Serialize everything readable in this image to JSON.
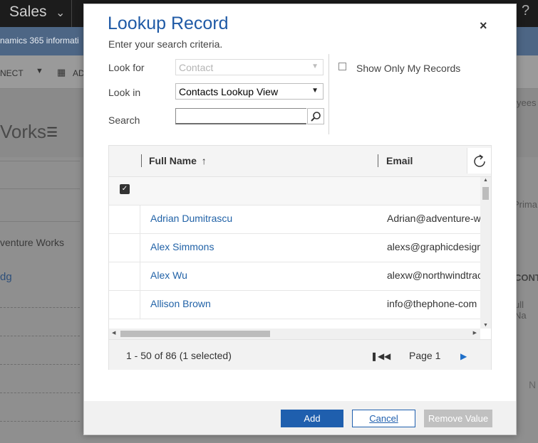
{
  "background": {
    "app_title": "Sales",
    "notice_text": "namics 365 informati",
    "cmd_connect": "NECT",
    "cmd_add": "AD",
    "page_heading": "Vorks",
    "left_company": "venture Works",
    "left_link": "dg",
    "right_text1": "yees",
    "right_text2": "Prima",
    "right_text3": "CONT",
    "right_text4": "ull Na",
    "right_text5": "N"
  },
  "dialog": {
    "title": "Lookup Record",
    "subtitle": "Enter your search criteria.",
    "close_label": "×",
    "look_for_label": "Look for",
    "look_for_value": "Contact",
    "look_in_label": "Look in",
    "look_in_value": "Contacts Lookup View",
    "search_label": "Search",
    "search_value": "",
    "show_only_mine_label": "Show Only My Records"
  },
  "grid": {
    "columns": [
      "Full Name",
      "Email"
    ],
    "sort_indicator": "↑",
    "rows": [
      {
        "name": "Adrian Dumitrascu",
        "email": "Adrian@adventure-w"
      },
      {
        "name": "Alex Simmons",
        "email": "alexs@graphicdesign"
      },
      {
        "name": "Alex Wu",
        "email": "alexw@northwindtrac"
      },
      {
        "name": "Allison Brown",
        "email": "info@thephone-com"
      }
    ],
    "record_count": "1 - 50 of 86 (1 selected)",
    "page_label": "Page 1"
  },
  "buttons": {
    "add": "Add",
    "cancel": "Cancel",
    "remove": "Remove Value"
  },
  "colors": {
    "accent": "#1f5fae",
    "title": "#1f5aa6",
    "link": "#2162a7"
  }
}
